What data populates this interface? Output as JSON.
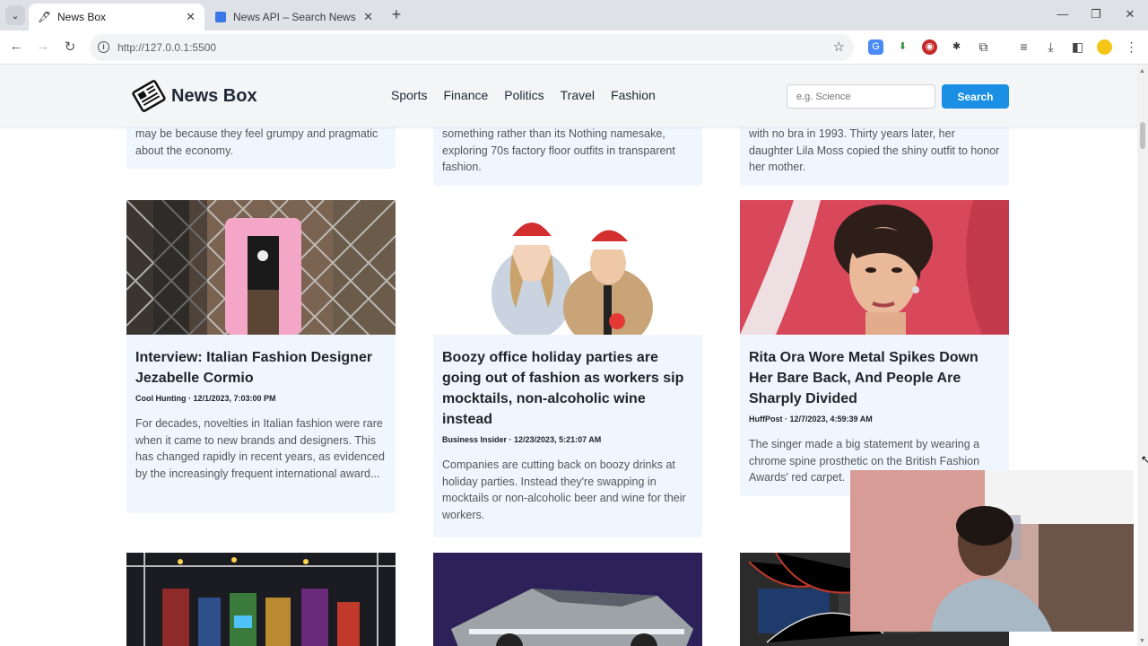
{
  "browser": {
    "tabs": [
      {
        "title": "News Box",
        "active": true
      },
      {
        "title": "News API – Search News and B",
        "active": false
      }
    ],
    "url": "http://127.0.0.1:5500"
  },
  "site": {
    "brand": "News Box",
    "nav": [
      "Sports",
      "Finance",
      "Politics",
      "Travel",
      "Fashion"
    ],
    "search_placeholder": "e.g. Science",
    "search_label": "Search"
  },
  "top_row": [
    {
      "desc": "may be because they feel grumpy and pragmatic about the economy."
    },
    {
      "desc": "something rather than its Nothing namesake, exploring 70s factory floor outfits in transparent fashion."
    },
    {
      "desc": "with no bra in 1993. Thirty years later, her daughter Lila Moss copied the shiny outfit to honor her mother."
    }
  ],
  "articles": [
    {
      "title": "Interview: Italian Fashion Designer Jezabelle Cormio",
      "meta": "Cool Hunting · 12/1/2023, 7:03:00 PM",
      "desc": "For decades, novelties in Italian fashion were rare when it came to new brands and designers. This has changed rapidly in recent years, as evidenced by the increasingly frequent international award..."
    },
    {
      "title": "Boozy office holiday parties are going out of fashion as workers sip mocktails, non-alcoholic wine instead",
      "meta": "Business Insider · 12/23/2023, 5:21:07 AM",
      "desc": "Companies are cutting back on boozy drinks at holiday parties. Instead they're swapping in mocktails or non-alcoholic beer and wine for their workers."
    },
    {
      "title": "Rita Ora Wore Metal Spikes Down Her Bare Back, And People Are Sharply Divided",
      "meta": "HuffPost · 12/7/2023, 4:59:39 AM",
      "desc": "The singer made a big statement by wearing a chrome spine prosthetic on the British Fashion Awards' red carpet."
    }
  ],
  "colors": {
    "accent": "#1a8fe3",
    "card_bg": "#f0f6ff",
    "header_bg": "#f4f5f7"
  }
}
